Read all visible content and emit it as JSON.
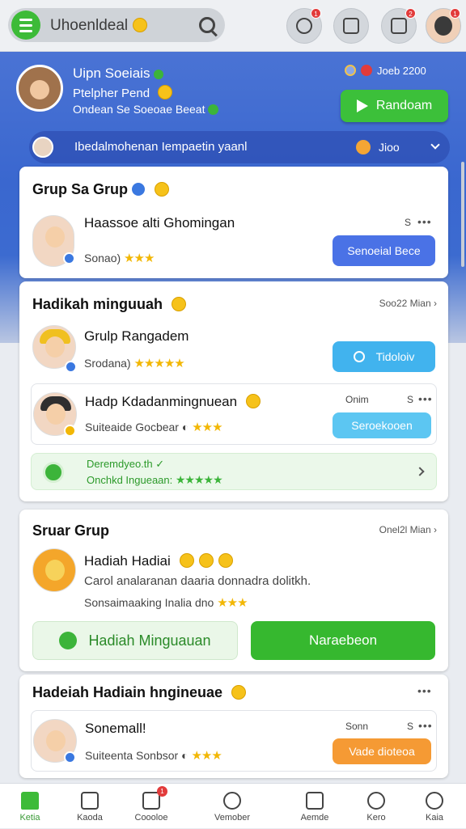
{
  "topbar": {
    "title": "Uhoenldeal",
    "badges": {
      "notif1": "1",
      "notif3": "2",
      "avatar": "1"
    }
  },
  "hero": {
    "name": "Uipn Soeiais",
    "subtitle": "Ptelpher Pend",
    "description": "Ondean Se Soeoae Beeat",
    "stat": "Joeb 2200",
    "random_button": "Randoam"
  },
  "filter": {
    "text": "Ibedalmohenan Iempaetin yaanl",
    "right_label": "Jioo"
  },
  "card1": {
    "title": "Grup Sa Grup",
    "item": {
      "name": "Haassoe alti Ghomingan",
      "sub": "Sonao)",
      "stars": "★★★",
      "meta": "S",
      "button": "Senoeial Bece"
    }
  },
  "card2": {
    "title": "Hadikah minguuah",
    "more": "Soo22 Mian",
    "items": [
      {
        "name": "Grulp Rangadem",
        "sub": "Srodana)",
        "stars": "★★★★★",
        "button": "Tidoloiv"
      },
      {
        "name": "Hadp Kdadanmingnuean",
        "sub": "Suiteaide Gocbear",
        "stars": "★★★",
        "meta1": "Onim",
        "meta2": "S",
        "button": "Seroekooen"
      }
    ],
    "green": {
      "line1": "Deremdyeo.th ✓",
      "line2": "Onchkd Ingueaan:",
      "stars": "★★★★★"
    }
  },
  "card3": {
    "title": "Sruar Grup",
    "more": "Onel2l Mian",
    "item": {
      "name": "Hadiah Hadiai",
      "desc": "Carol analaranan daaria donnadra dolitkh.",
      "sub": "Sonsaimaaking Inalia dno",
      "stars": "★★★"
    },
    "btn_left": "Hadiah Minguauan",
    "btn_right": "Naraebeon"
  },
  "card4": {
    "title": "Hadeiah Hadiain hngineuae",
    "item": {
      "name": "Sonemall!",
      "sub": "Suiteenta Sonbsor",
      "stars": "★★★",
      "meta1": "Sonn",
      "meta2": "S",
      "button": "Vade dioteoa"
    }
  },
  "nav": [
    {
      "label": "Ketia"
    },
    {
      "label": "Kaoda"
    },
    {
      "label": "Coooloe"
    },
    {
      "label": "Vemober"
    },
    {
      "label": "Aemde"
    },
    {
      "label": "Kero"
    },
    {
      "label": "Kaia"
    }
  ],
  "nav_badge": "1",
  "colors": {
    "accent": "#3dbb38",
    "primary": "#3a67cf",
    "button_blue": "#4a72e6",
    "button_cyan": "#41b3ee",
    "button_orange": "#f59a34"
  }
}
